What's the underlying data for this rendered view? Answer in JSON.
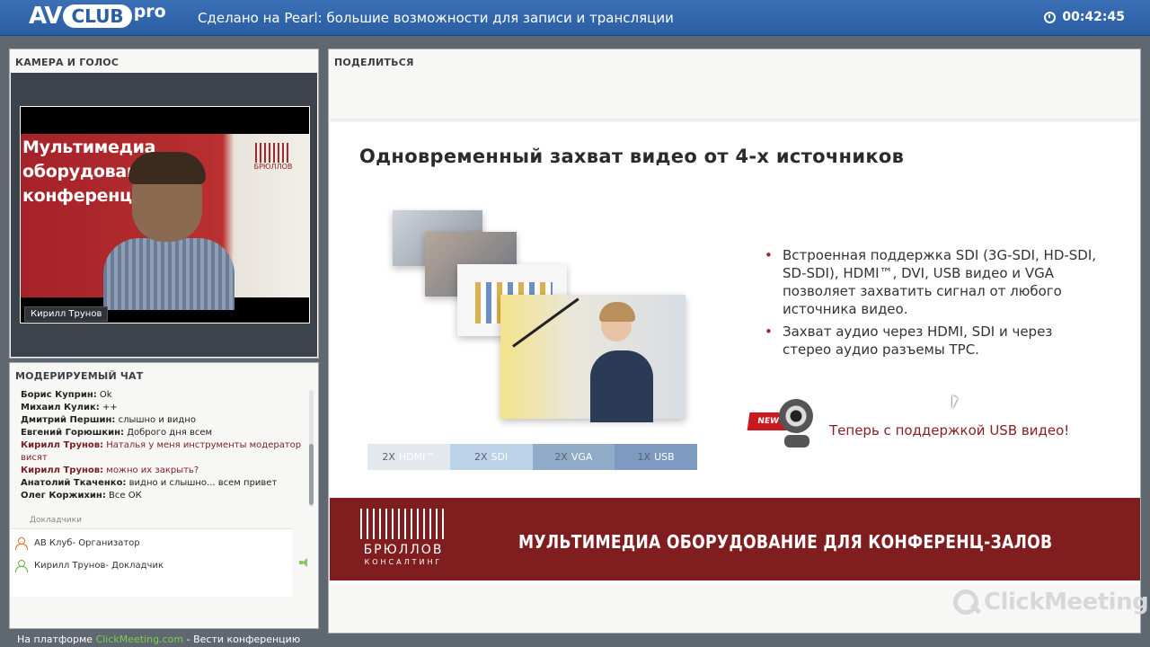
{
  "header": {
    "logo": {
      "av": "AV",
      "club": "CLUB",
      "pro": "pro"
    },
    "title": "Сделано на Pearl: большие возможности для записи и трансляции",
    "timer": "00:42:45"
  },
  "camera_panel": {
    "title": "КАМЕРА И ГОЛОС",
    "video_text": [
      "Мультимедиа",
      "оборудован",
      "конференц"
    ],
    "video_brand": "БРЮЛЛОВ",
    "speaker_name": "Кирилл Трунов"
  },
  "chat_panel": {
    "title": "МОДЕРИРУЕМЫЙ ЧАТ",
    "messages": [
      {
        "author": "Борис Куприн:",
        "text": " Ok"
      },
      {
        "author": "Михаил Кулик:",
        "text": " ++"
      },
      {
        "author": "Дмитрий Першин:",
        "text": " слышно и видно"
      },
      {
        "author": "Евгений Горюшкин:",
        "text": " Доброго дня всем"
      },
      {
        "author": "Кирилл Трунов:",
        "text": " Наталья у меня инструменты модератор висят"
      },
      {
        "author": "Кирилл Трунов:",
        "text": " можно их закрыть?"
      },
      {
        "author": "Анатолий Ткаченко:",
        "text": " видно и слышно... всем привет"
      },
      {
        "author": "Олег Коржихин:",
        "text": " Все ОК"
      }
    ],
    "participants_header": "Докладчики",
    "participants": [
      {
        "name": "АВ Клуб",
        "role": " - Организатор"
      },
      {
        "name": "Кирилл Трунов",
        "role": " - Докладчик"
      }
    ]
  },
  "footer": {
    "prefix": "На платформе ",
    "link": "ClickMeeting.com",
    "suffix": " - Вести конференцию"
  },
  "share_panel": {
    "title": "ПОДЕЛИТЬСЯ",
    "slide": {
      "title": "Одновременный захват видео от 4-х источников",
      "tabs": [
        {
          "count": "2X",
          "label": "HDMI™"
        },
        {
          "count": "2X",
          "label": "SDI"
        },
        {
          "count": "2X",
          "label": "VGA"
        },
        {
          "count": "1X",
          "label": "USB"
        }
      ],
      "bullets": [
        "Встроенная поддержка SDI (3G-SDI, HD-SDI, SD-SDI), HDMI™, DVI, USB видео и VGA позволяет захватить сигнал от любого источника видео.",
        "Захват аудио через HDMI, SDI и через стерео аудио разъемы TPC."
      ],
      "new_badge": "NEW",
      "usb_text": "Теперь с поддержкой USB видео!",
      "banner": {
        "brand": "БРЮЛЛОВ",
        "brand_sub": "КОНСАЛТИНГ",
        "text": "МУЛЬТИМЕДИА ОБОРУДОВАНИЕ ДЛЯ КОНФЕРЕНЦ-ЗАЛОВ"
      }
    },
    "watermark": "ClickMeeting"
  }
}
